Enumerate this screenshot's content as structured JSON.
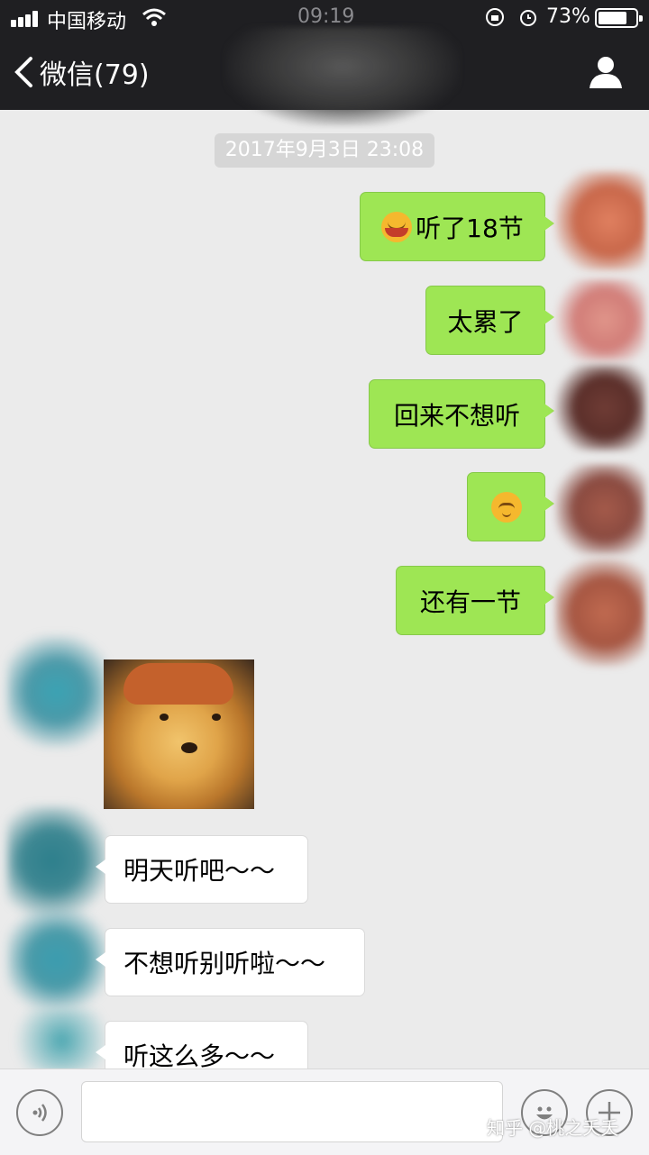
{
  "status_bar": {
    "carrier": "中国移动",
    "time": "09:19",
    "battery_percent": "73%",
    "battery_level": 0.73
  },
  "nav": {
    "back_label": "微信(79)",
    "icons": {
      "back": "chevron-left-icon",
      "profile": "person-icon"
    }
  },
  "chat": {
    "timestamp": "2017年9月3日 23:08",
    "sent_messages": [
      {
        "text": "听了18节",
        "emoji": "laughing-tears-emoji"
      },
      {
        "text": "太累了"
      },
      {
        "text": "回来不想听"
      },
      {
        "text": "",
        "emoji": "shy-smile-emoji"
      },
      {
        "text": "还有一节"
      }
    ],
    "received_sticker": "shiba-dog-sticker",
    "received_messages": [
      {
        "text": "明天听吧～～"
      },
      {
        "text": "不想听别听啦～～"
      },
      {
        "text": "听这么多～～"
      }
    ]
  },
  "input_bar": {
    "icons": {
      "voice": "voice-icon",
      "emoji": "smiley-icon",
      "more": "plus-icon"
    }
  },
  "watermark": "知乎 @桃之夭夭",
  "colors": {
    "nav_bg": "#1f1f22",
    "chat_bg": "#ebebeb",
    "sent_bubble": "#9ee654",
    "received_bubble": "#ffffff"
  }
}
